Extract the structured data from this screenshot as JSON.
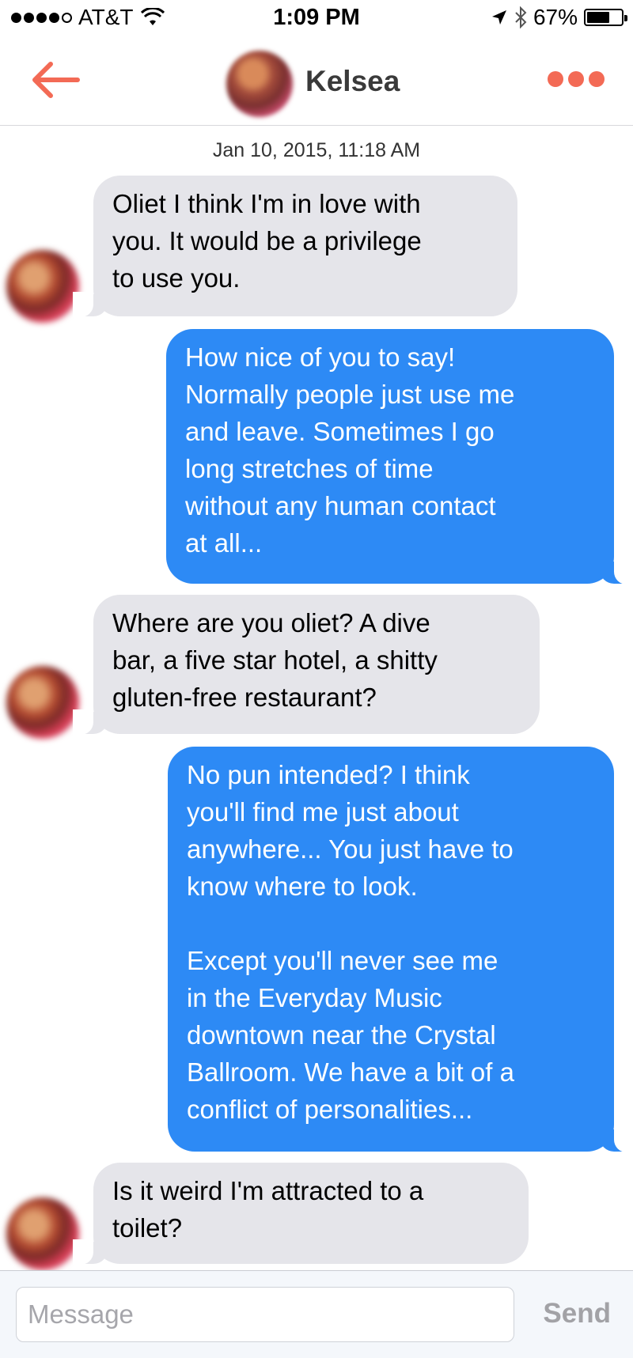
{
  "status_bar": {
    "carrier": "AT&T",
    "time": "1:09 PM",
    "battery": "67%",
    "battery_level": 0.67
  },
  "header": {
    "contact_name": "Kelsea",
    "back_icon": "back-arrow-icon",
    "more_icon": "more-dots-icon",
    "accent_color": "#f36a55"
  },
  "conversation": {
    "timestamp": "Jan 10, 2015, 11:18 AM",
    "messages": [
      {
        "from": "them",
        "text": "Oliet I think I'm in love with\nyou. It would be a privilege\nto use you."
      },
      {
        "from": "me",
        "text": "How nice of you to say!\nNormally people just use me\nand leave. Sometimes I go\nlong stretches of time\nwithout any human contact\nat all..."
      },
      {
        "from": "them",
        "text": "Where are you oliet? A dive\nbar, a five star hotel, a shitty\ngluten-free restaurant?"
      },
      {
        "from": "me",
        "text": "No pun intended? I think\nyou'll find me just about\nanywhere... You just have to\nknow where to look.\n\nExcept you'll never see me\nin the Everyday Music\ndowntown near the Crystal\nBallroom. We have a bit of a\nconflict of personalities..."
      },
      {
        "from": "them",
        "text": "Is it weird I'm attracted to a\ntoilet?"
      }
    ]
  },
  "composer": {
    "placeholder": "Message",
    "value": "",
    "send_label": "Send"
  },
  "colors": {
    "outgoing_bubble": "#2d8af5",
    "incoming_bubble": "#e5e5ea"
  }
}
